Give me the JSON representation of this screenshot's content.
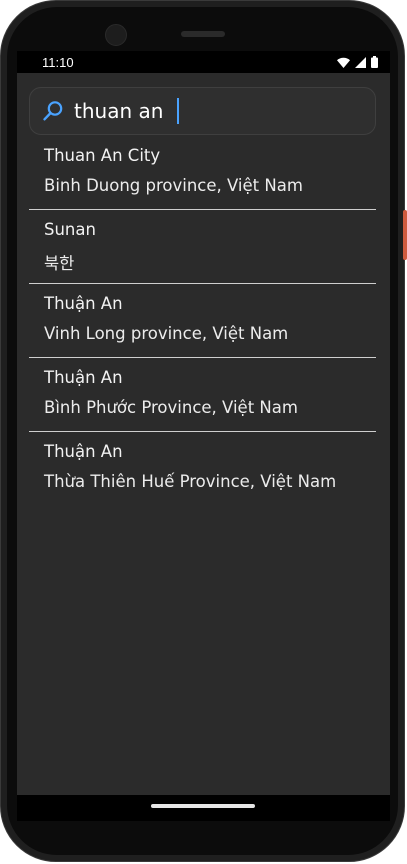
{
  "status_bar": {
    "time": "11:10",
    "icons": [
      "wifi-icon",
      "cellular-signal-icon",
      "battery-icon"
    ]
  },
  "search": {
    "value": "thuan an",
    "icon": "search-icon",
    "accent_color": "#4aa3ff"
  },
  "results": [
    {
      "name": "Thuan An City",
      "detail": "Binh Duong province, Việt Nam"
    },
    {
      "name": "Sunan",
      "detail": "북한"
    },
    {
      "name": "Thuận An",
      "detail": "Vinh Long province, Việt Nam"
    },
    {
      "name": "Thuận An",
      "detail": "Bình Phước Province, Việt Nam"
    },
    {
      "name": "Thuận An",
      "detail": "Thừa Thiên Huế Province, Việt Nam"
    }
  ]
}
